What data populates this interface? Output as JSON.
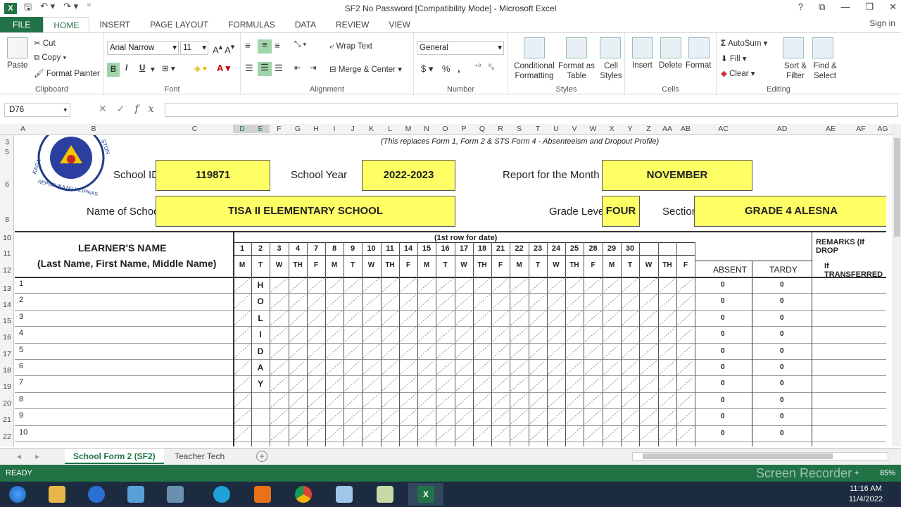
{
  "window": {
    "title": "SF2 No Password  [Compatibility Mode] - Microsoft Excel",
    "app_icon": "X",
    "controls": [
      "?",
      "⧉",
      "—",
      "❐",
      "✕"
    ]
  },
  "ribbon_tabs": [
    "FILE",
    "HOME",
    "INSERT",
    "PAGE LAYOUT",
    "FORMULAS",
    "DATA",
    "REVIEW",
    "VIEW"
  ],
  "signin": "Sign in",
  "clipboard": {
    "paste": "Paste",
    "cut": "Cut",
    "copy": "Copy",
    "format_painter": "Format Painter",
    "label": "Clipboard"
  },
  "font": {
    "name": "Arial Narrow",
    "size": "11",
    "label": "Font",
    "bold": "B",
    "italic": "I",
    "underline": "U"
  },
  "alignment": {
    "wrap": "Wrap Text",
    "merge": "Merge & Center",
    "label": "Alignment"
  },
  "number": {
    "format": "General",
    "currency": "$",
    "percent": "%",
    "comma": ",",
    "label": "Number"
  },
  "styles": {
    "conditional": "Conditional Formatting",
    "format_table": "Format as Table",
    "cell_styles": "Cell Styles",
    "label": "Styles"
  },
  "cells": {
    "insert": "Insert",
    "delete": "Delete",
    "format": "Format",
    "label": "Cells"
  },
  "editing": {
    "autosum": "AutoSum",
    "fill": "Fill",
    "clear": "Clear",
    "sort": "Sort & Filter",
    "find": "Find & Select",
    "label": "Editing"
  },
  "formula_bar": {
    "name_box": "D76",
    "fx": "fx",
    "content": ""
  },
  "columns": [
    "A",
    "B",
    "C",
    "D",
    "E",
    "F",
    "G",
    "H",
    "I",
    "J",
    "K",
    "L",
    "M",
    "N",
    "O",
    "P",
    "Q",
    "R",
    "S",
    "T",
    "U",
    "V",
    "W",
    "X",
    "Y",
    "Z",
    "AA",
    "AB",
    "AC",
    "AD",
    "AE",
    "AF",
    "AG"
  ],
  "rows": [
    "3",
    "5",
    "6",
    "8",
    "10",
    "11",
    "12",
    "13",
    "14",
    "15",
    "16",
    "17",
    "18",
    "19",
    "20",
    "21",
    "22"
  ],
  "sheet": {
    "replaces_note": "(This replaces Form 1, Form 2 & STS Form 4 - Absenteeism and Dropout Profile)",
    "logo_text_top": "KAGA",
    "logo_text_right": "STON",
    "logo_text_bottom": "REPUBLIKA NG PILIPINAS",
    "school_id_label": "School ID",
    "school_id": "119871",
    "school_year_label": "School Year",
    "school_year": "2022-2023",
    "month_label": "Report for the  Month of",
    "month": "NOVEMBER",
    "school_name_label": "Name of School",
    "school_name": "TISA II ELEMENTARY SCHOOL",
    "grade_label": "Grade Level",
    "grade": "FOUR",
    "section_label": "Section",
    "section": "GRADE 4 ALESNA",
    "learner_header_1": "LEARNER'S NAME",
    "learner_header_2": "(Last Name, First Name, Middle Name)",
    "date_row_note": "(1st row for date)",
    "dates": [
      "1",
      "2",
      "3",
      "4",
      "7",
      "8",
      "9",
      "10",
      "11",
      "14",
      "15",
      "16",
      "17",
      "18",
      "21",
      "22",
      "23",
      "24",
      "25",
      "28",
      "29",
      "30",
      ""
    ],
    "weekdays": [
      "M",
      "T",
      "W",
      "TH",
      "F",
      "M",
      "T",
      "W",
      "TH",
      "F",
      "M",
      "T",
      "W",
      "TH",
      "F",
      "M",
      "T",
      "W",
      "TH",
      "F",
      "M",
      "T",
      "W",
      "TH",
      "F"
    ],
    "absent": "ABSENT",
    "tardy": "TARDY",
    "remarks_1": "REMARKS (If DROP",
    "remarks_2": "If TRANSFERRED",
    "holiday_letters": [
      "H",
      "O",
      "L",
      "I",
      "D",
      "A",
      "Y"
    ],
    "learner_numbers": [
      "1",
      "2",
      "3",
      "4",
      "5",
      "6",
      "7",
      "8",
      "9",
      "10"
    ],
    "absent_values": [
      "0",
      "0",
      "0",
      "0",
      "0",
      "0",
      "0",
      "0",
      "0",
      "0"
    ],
    "tardy_values": [
      "0",
      "0",
      "0",
      "0",
      "0",
      "0",
      "0",
      "0",
      "0",
      "0"
    ]
  },
  "sheet_tabs": [
    "School Form 2 (SF2)",
    "Teacher Tech"
  ],
  "status": {
    "ready": "READY",
    "zoom": "85%",
    "recorder": "Screen Recorder"
  },
  "clock": {
    "time": "11:16 AM",
    "date": "11/4/2022"
  }
}
